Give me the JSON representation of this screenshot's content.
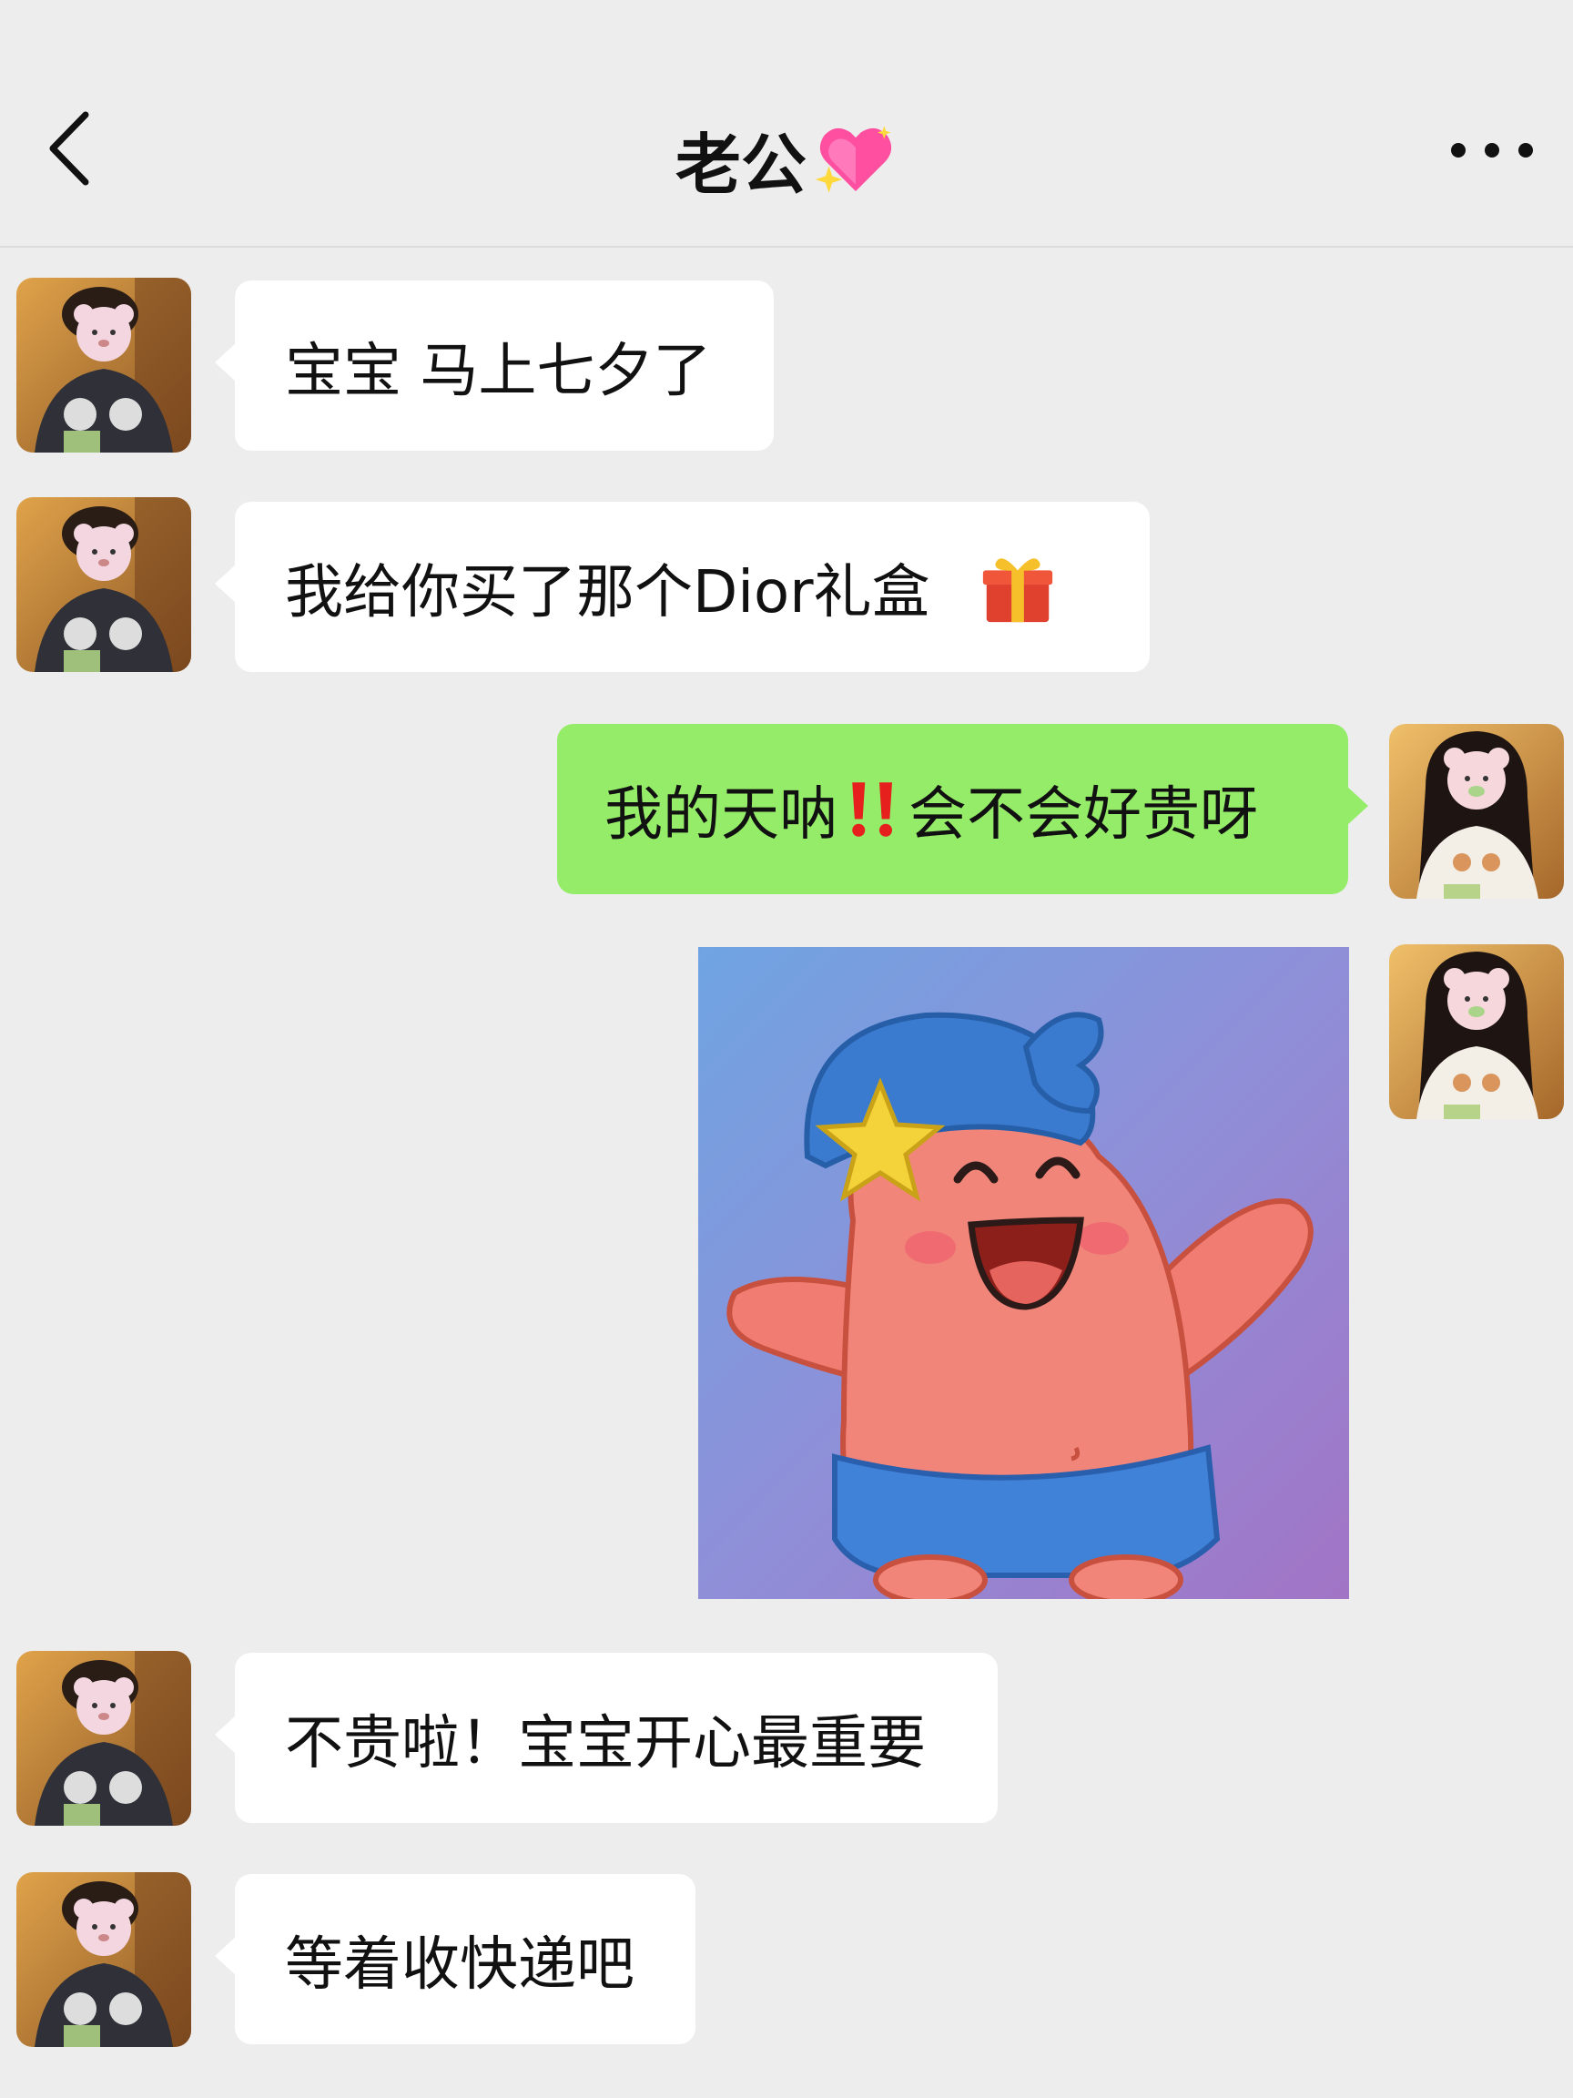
{
  "header": {
    "title": "老公",
    "title_emoji": "sparkling-heart-icon",
    "back_icon": "chevron-left-icon",
    "more_icon": "more-dots-icon"
  },
  "messages": [
    {
      "side": "left",
      "text": "宝宝 马上七夕了"
    },
    {
      "side": "left",
      "text": "我给你买了那个Dior礼盒",
      "emoji": "gift-icon"
    },
    {
      "side": "right",
      "text_before": "我的天呐",
      "emoji": "double-exclamation-icon",
      "text_after": "会不会好贵呀"
    },
    {
      "side": "right",
      "type": "sticker",
      "sticker": "happy-pink-starfish-sticker"
    },
    {
      "side": "left",
      "text": "不贵啦！宝宝开心最重要"
    },
    {
      "side": "left",
      "text": "等着收快递吧"
    }
  ],
  "colors": {
    "background": "#ededed",
    "incoming_bubble": "#ffffff",
    "outgoing_bubble": "#95ec69",
    "text": "#111111"
  }
}
